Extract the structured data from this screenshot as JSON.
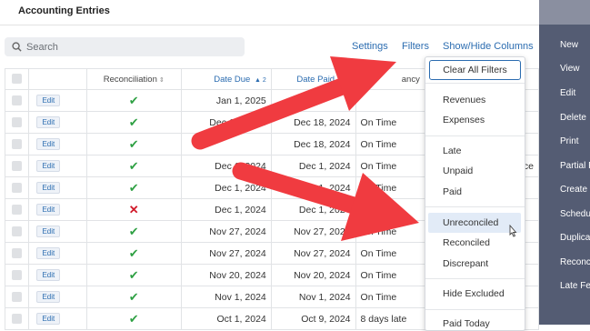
{
  "header": {
    "title": "Accounting Entries"
  },
  "search": {
    "placeholder": "Search"
  },
  "toolbar": {
    "settings": "Settings",
    "filters": "Filters",
    "show_hide": "Show/Hide Columns"
  },
  "table": {
    "columns": {
      "reconciliation": "Reconciliation",
      "date_due": "Date Due",
      "date_due_sort": "▲ 2",
      "date_paid": "Date Paid",
      "date_paid_sort": "▼ 1",
      "discrepancy_partial": "ancy"
    },
    "edit_label": "Edit",
    "rows": [
      {
        "reconciled": "yes",
        "date_due": "Jan 1, 2025",
        "date_paid": "",
        "discrepancy": "",
        "extra": ""
      },
      {
        "reconciled": "yes",
        "date_due": "Dec 18, 2024",
        "date_paid": "Dec 18, 2024",
        "discrepancy": "On Time",
        "extra": ""
      },
      {
        "reconciled": "yes",
        "date_due": "",
        "date_paid": "Dec 18, 2024",
        "discrepancy": "On Time",
        "extra": ""
      },
      {
        "reconciled": "yes",
        "date_due": "Dec 1, 2024",
        "date_paid": "Dec 1, 2024",
        "discrepancy": "On Time",
        "extra": "ce"
      },
      {
        "reconciled": "yes",
        "date_due": "Dec 1, 2024",
        "date_paid": "Dec 1, 2024",
        "discrepancy": "On Time",
        "extra": ""
      },
      {
        "reconciled": "no",
        "date_due": "Dec 1, 2024",
        "date_paid": "Dec 1, 2024",
        "discrepancy": "On Time",
        "extra": ""
      },
      {
        "reconciled": "yes",
        "date_due": "Nov 27, 2024",
        "date_paid": "Nov 27, 2024",
        "discrepancy": "On Time",
        "extra": ""
      },
      {
        "reconciled": "yes",
        "date_due": "Nov 27, 2024",
        "date_paid": "Nov 27, 2024",
        "discrepancy": "On Time",
        "extra": ""
      },
      {
        "reconciled": "yes",
        "date_due": "Nov 20, 2024",
        "date_paid": "Nov 20, 2024",
        "discrepancy": "On Time",
        "extra": ""
      },
      {
        "reconciled": "yes",
        "date_due": "Nov 1, 2024",
        "date_paid": "Nov 1, 2024",
        "discrepancy": "On Time",
        "extra": ""
      },
      {
        "reconciled": "yes",
        "date_due": "Oct 1, 2024",
        "date_paid": "Oct 9, 2024",
        "discrepancy": "8 days late",
        "extra": ""
      }
    ]
  },
  "filters_menu": {
    "clear_all": "Clear All Filters",
    "revenues": "Revenues",
    "expenses": "Expenses",
    "late": "Late",
    "unpaid": "Unpaid",
    "paid": "Paid",
    "unreconciled": "Unreconciled",
    "reconciled": "Reconciled",
    "discrepant": "Discrepant",
    "hide_excluded": "Hide Excluded",
    "paid_today": "Paid Today"
  },
  "sidebar": {
    "items": [
      "New",
      "View",
      "Edit",
      "Delete",
      "Print",
      "Partial P",
      "Create C",
      "Schedu",
      "Duplica",
      "Reconc",
      "Late Fe"
    ]
  },
  "colors": {
    "accent": "#2b6cb0",
    "sidebar": "#545c73",
    "arrow": "#f03b40",
    "check": "#2ea043",
    "cross": "#d11a2a"
  }
}
